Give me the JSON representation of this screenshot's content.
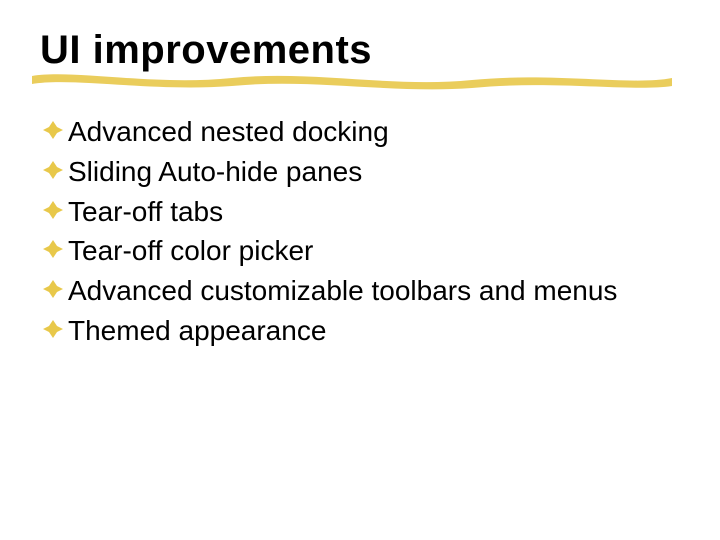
{
  "title": "UI improvements",
  "bullets": [
    {
      "text": "Advanced nested docking"
    },
    {
      "text": "Sliding Auto-hide panes"
    },
    {
      "text": "Tear-off tabs"
    },
    {
      "text": "Tear-off color picker"
    },
    {
      "text": "Advanced customizable toolbars and menus"
    },
    {
      "text": "Themed appearance"
    }
  ],
  "colors": {
    "accent": "#e8c84a"
  }
}
